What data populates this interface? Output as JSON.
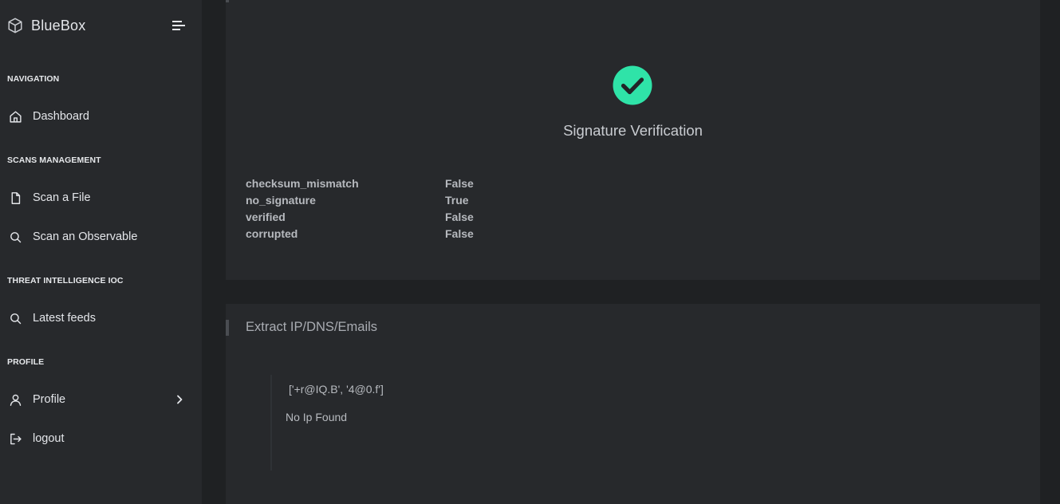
{
  "app": {
    "brand": "BlueBox",
    "brand_icon": "cube-icon",
    "menu_icon": "menu-toggle-icon"
  },
  "sidebar": {
    "sections": [
      {
        "title": "NAVIGATION",
        "items": [
          {
            "label": "Dashboard",
            "icon": "home-icon"
          }
        ]
      },
      {
        "title": "SCANS MANAGEMENT",
        "items": [
          {
            "label": "Scan a File",
            "icon": "file-icon"
          },
          {
            "label": "Scan an Observable",
            "icon": "search-icon"
          }
        ]
      },
      {
        "title": "THREAT INTELLIGENCE IOC",
        "items": [
          {
            "label": "Latest feeds",
            "icon": "search-icon"
          }
        ]
      },
      {
        "title": "PROFILE",
        "items": [
          {
            "label": "Profile",
            "icon": "user-icon",
            "has_submenu": true
          },
          {
            "label": "logout",
            "icon": "logout-icon"
          }
        ]
      }
    ]
  },
  "signature": {
    "status_icon": "check-circle-icon",
    "status_color": "#2fe3a8",
    "title": "Signature Verification",
    "fields": [
      {
        "key": "checksum_mismatch",
        "value": "False"
      },
      {
        "key": "no_signature",
        "value": "True"
      },
      {
        "key": "verified",
        "value": "False"
      },
      {
        "key": "corrupted",
        "value": "False"
      }
    ]
  },
  "extract": {
    "title": "Extract IP/DNS/Emails",
    "emails": "['+r@IQ.B', '4@0.f']",
    "ip_result": "No Ip Found"
  },
  "colors": {
    "sidebar_bg": "#27292c",
    "page_bg": "#1f2123",
    "card_bg": "#27292c",
    "accent_green": "#2fe3a8"
  }
}
